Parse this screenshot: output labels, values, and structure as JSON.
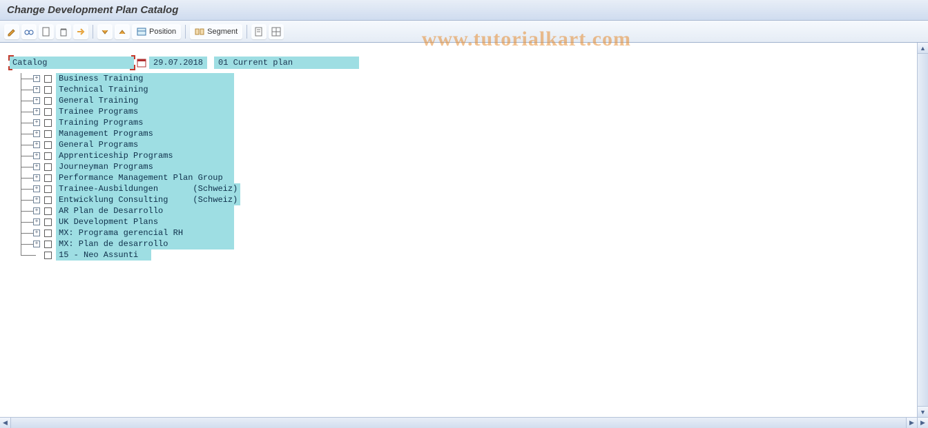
{
  "title": "Change Development Plan Catalog",
  "toolbar": {
    "position_label": "Position",
    "segment_label": "Segment"
  },
  "catalog": {
    "label": "Catalog",
    "date": "29.07.2018",
    "plan": "01 Current plan"
  },
  "tree": {
    "items": [
      {
        "label": "Business Training",
        "expandable": true
      },
      {
        "label": "Technical Training",
        "expandable": true
      },
      {
        "label": "General Training",
        "expandable": true
      },
      {
        "label": "Trainee Programs",
        "expandable": true
      },
      {
        "label": "Training Programs",
        "expandable": true
      },
      {
        "label": "Management Programs",
        "expandable": true
      },
      {
        "label": "General Programs",
        "expandable": true
      },
      {
        "label": "Apprenticeship Programs",
        "expandable": true
      },
      {
        "label": "Journeyman Programs",
        "expandable": true
      },
      {
        "label": "Performance Management Plan Group",
        "expandable": true
      },
      {
        "label": "Trainee-Ausbildungen       (Schweiz)",
        "expandable": true
      },
      {
        "label": "Entwicklung Consulting     (Schweiz)",
        "expandable": true
      },
      {
        "label": "AR Plan de Desarrollo",
        "expandable": true
      },
      {
        "label": "UK Development Plans",
        "expandable": true
      },
      {
        "label": "MX: Programa gerencial RH",
        "expandable": true
      },
      {
        "label": "MX: Plan de desarrollo",
        "expandable": true
      },
      {
        "label": "15 - Neo Assunti",
        "expandable": false
      }
    ]
  },
  "watermark": "www.tutorialkart.com"
}
